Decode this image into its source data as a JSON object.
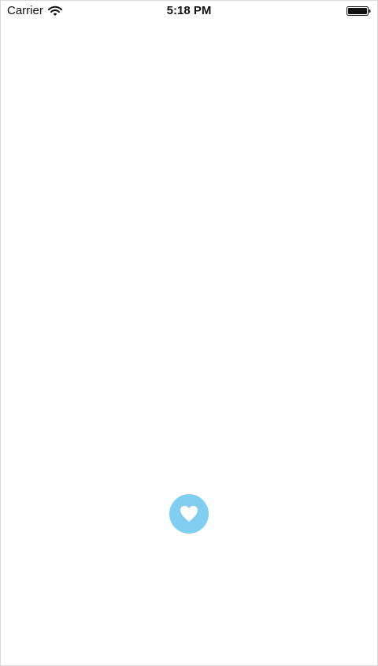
{
  "status_bar": {
    "carrier": "Carrier",
    "time": "5:18 PM",
    "wifi_icon": "wifi-icon",
    "battery_icon": "battery-icon"
  },
  "like_button": {
    "icon": "heart-icon",
    "color": "#80cdf2"
  }
}
